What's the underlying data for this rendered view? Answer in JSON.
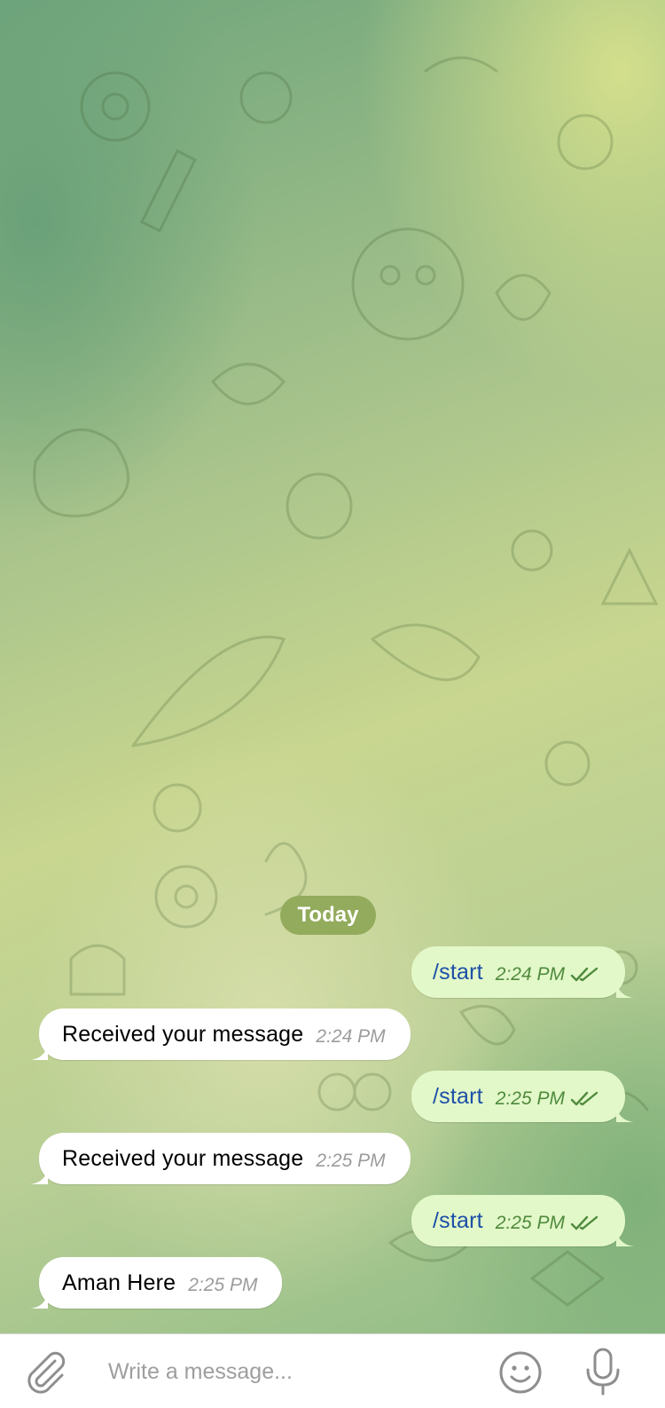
{
  "chat": {
    "date_separator": "Today",
    "messages": [
      {
        "direction": "out",
        "text": "/start",
        "time": "2:24 PM",
        "status": "read"
      },
      {
        "direction": "in",
        "text": "Received your message",
        "time": "2:24 PM"
      },
      {
        "direction": "out",
        "text": "/start",
        "time": "2:25 PM",
        "status": "read"
      },
      {
        "direction": "in",
        "text": "Received your message",
        "time": "2:25 PM"
      },
      {
        "direction": "out",
        "text": "/start",
        "time": "2:25 PM",
        "status": "read"
      },
      {
        "direction": "in",
        "text": "Aman Here",
        "time": "2:25 PM"
      }
    ]
  },
  "composer": {
    "placeholder": "Write a message...",
    "value": "",
    "icons": {
      "attach": "paperclip-icon",
      "emoji": "smiley-icon",
      "voice": "microphone-icon"
    }
  },
  "colors": {
    "outgoing_bubble": "#e2f8c8",
    "incoming_bubble": "#ffffff",
    "outgoing_text": "#1d4fa8",
    "outgoing_time": "#4f8a3d",
    "date_pill": "#92ab5c"
  }
}
